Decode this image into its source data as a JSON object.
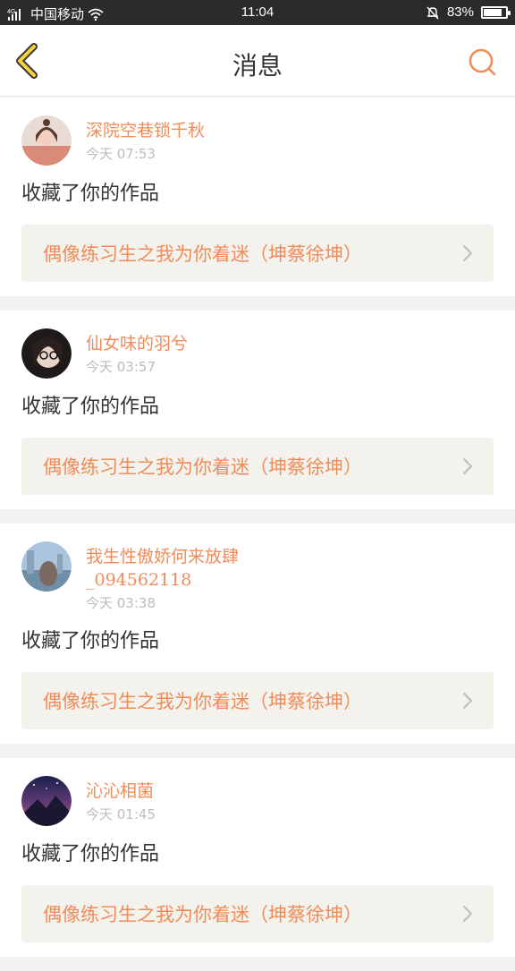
{
  "status_bar": {
    "carrier": "中国移动",
    "signal_label": "4G",
    "time": "11:04",
    "battery": "83%",
    "battery_level": 0.83
  },
  "header": {
    "title": "消息",
    "back_icon": "chevron-left-icon",
    "search_icon": "search-icon"
  },
  "colors": {
    "accent": "#f08c5a",
    "back_yellow": "#f5d33b",
    "work_bg": "#f3f2ed"
  },
  "messages": [
    {
      "username": "深院空巷锁千秋",
      "time": "今天 07:53",
      "action": "收藏了你的作品",
      "work_title": "偶像练习生之我为你着迷（坤蔡徐坤）"
    },
    {
      "username": "仙女味的羽兮",
      "time": "今天 03:57",
      "action": "收藏了你的作品",
      "work_title": "偶像练习生之我为你着迷（坤蔡徐坤）"
    },
    {
      "username": "我生性傲娇何来放肆",
      "username_line2": "_094562118",
      "time": "今天 03:38",
      "action": "收藏了你的作品",
      "work_title": "偶像练习生之我为你着迷（坤蔡徐坤）"
    },
    {
      "username": "沁沁相菌",
      "time": "今天 01:45",
      "action": "收藏了你的作品",
      "work_title": "偶像练习生之我为你着迷（坤蔡徐坤）"
    }
  ]
}
